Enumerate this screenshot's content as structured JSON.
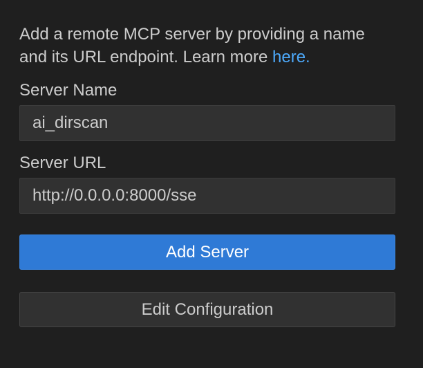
{
  "intro": {
    "text": "Add a remote MCP server by providing a name and its URL endpoint. Learn more ",
    "link_label": "here."
  },
  "server_name": {
    "label": "Server Name",
    "value": "ai_dirscan"
  },
  "server_url": {
    "label": "Server URL",
    "value": "http://0.0.0.0:8000/sse"
  },
  "buttons": {
    "add_server": "Add Server",
    "edit_configuration": "Edit Configuration"
  },
  "colors": {
    "background": "#1f1f1f",
    "input_background": "#313131",
    "primary_button": "#2f7ad6",
    "link": "#4daafc",
    "text": "#cccccc"
  }
}
